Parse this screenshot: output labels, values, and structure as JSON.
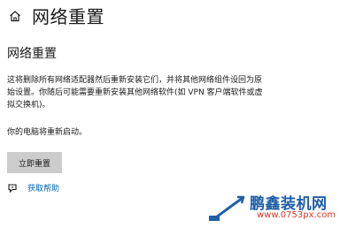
{
  "header": {
    "home_icon": "home-icon",
    "title": "网络重置"
  },
  "main": {
    "section_title": "网络重置",
    "description": "这将删除所有网络适配器然后重新安装它们，并将其他网络组件设回为原始设置。你随后可能需要重新安装其他网络软件(如 VPN 客户端软件或虚拟交换机)。",
    "restart_note": "你的电脑将重新启动。",
    "reset_button_label": "立即重置",
    "help_icon": "help-chat-icon",
    "help_link_label": "获取帮助"
  },
  "watermark": {
    "title": "鹏鑫装机网",
    "url": "www.0753px.com"
  },
  "colors": {
    "link": "#0067b8",
    "button_bg": "#cccccc",
    "watermark_title": "#1f5fa8",
    "watermark_url": "#d33a2c"
  }
}
